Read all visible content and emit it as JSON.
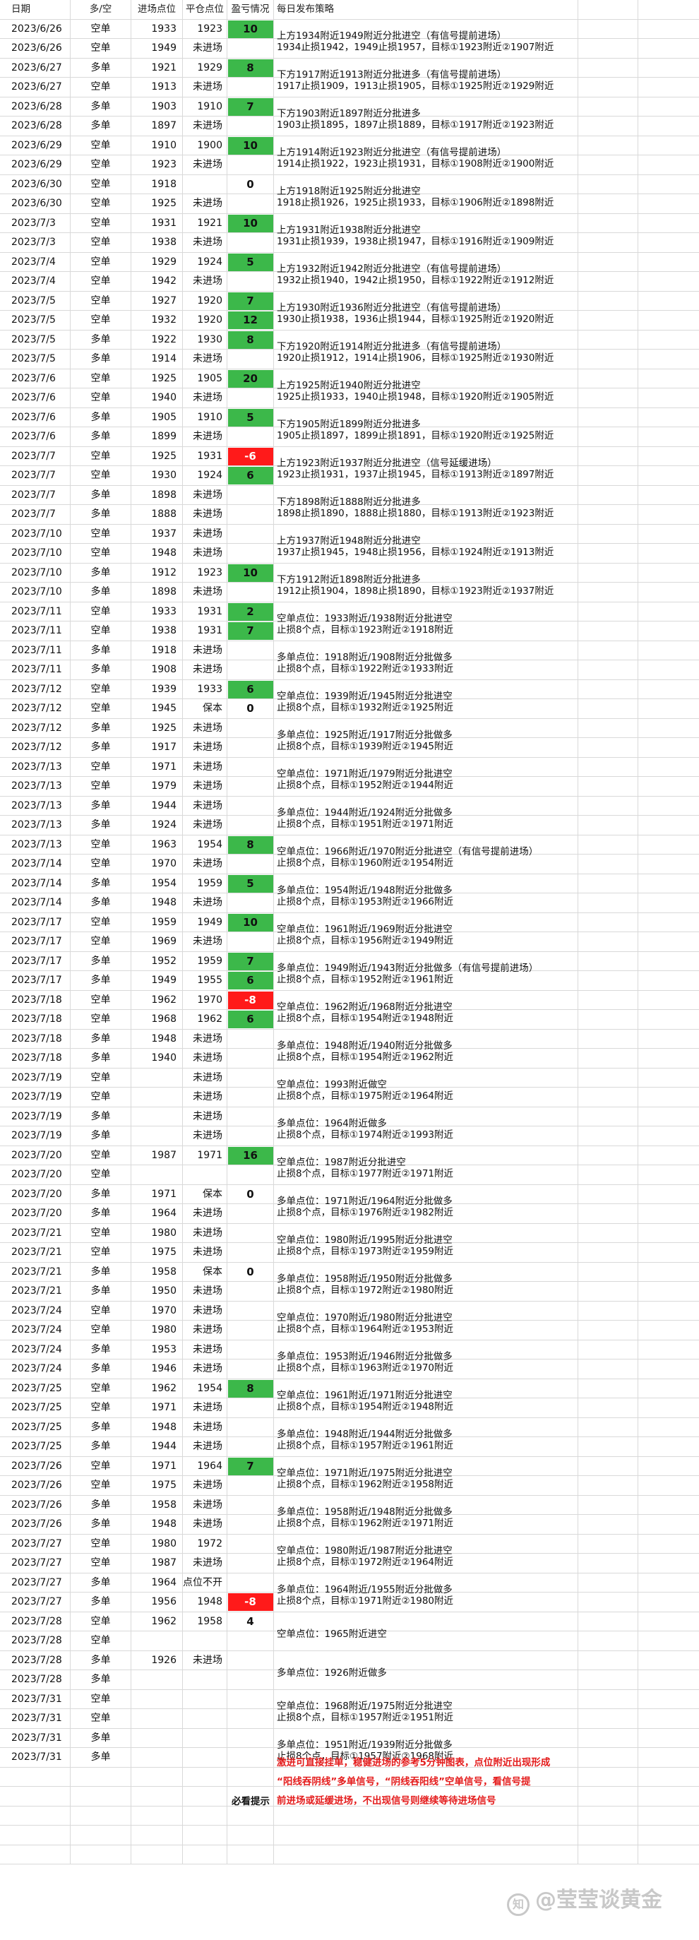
{
  "header": {
    "date": "日期",
    "direction": "多/空",
    "entry": "进场点位",
    "close": "平仓点位",
    "pnl": "盈亏情况",
    "strategy": "每日发布策略"
  },
  "rows": [
    {
      "date": "2023/6/26",
      "dir": "空单",
      "entry": "1933",
      "close": "1923",
      "pnl": "10",
      "pnl_color": "green"
    },
    {
      "date": "2023/6/26",
      "dir": "空单",
      "entry": "1949",
      "close": "未进场",
      "pnl": ""
    },
    {
      "date": "2023/6/27",
      "dir": "多单",
      "entry": "1921",
      "close": "1929",
      "pnl": "8",
      "pnl_color": "green"
    },
    {
      "date": "2023/6/27",
      "dir": "空单",
      "entry": "1913",
      "close": "未进场",
      "pnl": ""
    },
    {
      "date": "2023/6/28",
      "dir": "多单",
      "entry": "1903",
      "close": "1910",
      "pnl": "7",
      "pnl_color": "green"
    },
    {
      "date": "2023/6/28",
      "dir": "多单",
      "entry": "1897",
      "close": "未进场",
      "pnl": ""
    },
    {
      "date": "2023/6/29",
      "dir": "空单",
      "entry": "1910",
      "close": "1900",
      "pnl": "10",
      "pnl_color": "green"
    },
    {
      "date": "2023/6/29",
      "dir": "空单",
      "entry": "1923",
      "close": "未进场",
      "pnl": ""
    },
    {
      "date": "2023/6/30",
      "dir": "空单",
      "entry": "1918",
      "close": "",
      "pnl": "0",
      "pnl_color": "plain"
    },
    {
      "date": "2023/6/30",
      "dir": "空单",
      "entry": "1925",
      "close": "未进场",
      "pnl": ""
    },
    {
      "date": "2023/7/3",
      "dir": "空单",
      "entry": "1931",
      "close": "1921",
      "pnl": "10",
      "pnl_color": "green"
    },
    {
      "date": "2023/7/3",
      "dir": "空单",
      "entry": "1938",
      "close": "未进场",
      "pnl": ""
    },
    {
      "date": "2023/7/4",
      "dir": "空单",
      "entry": "1929",
      "close": "1924",
      "pnl": "5",
      "pnl_color": "green"
    },
    {
      "date": "2023/7/4",
      "dir": "空单",
      "entry": "1942",
      "close": "未进场",
      "pnl": ""
    },
    {
      "date": "2023/7/5",
      "dir": "空单",
      "entry": "1927",
      "close": "1920",
      "pnl": "7",
      "pnl_color": "green"
    },
    {
      "date": "2023/7/5",
      "dir": "空单",
      "entry": "1932",
      "close": "1920",
      "pnl": "12",
      "pnl_color": "green"
    },
    {
      "date": "2023/7/5",
      "dir": "多单",
      "entry": "1922",
      "close": "1930",
      "pnl": "8",
      "pnl_color": "green"
    },
    {
      "date": "2023/7/5",
      "dir": "多单",
      "entry": "1914",
      "close": "未进场",
      "pnl": ""
    },
    {
      "date": "2023/7/6",
      "dir": "空单",
      "entry": "1925",
      "close": "1905",
      "pnl": "20",
      "pnl_color": "green"
    },
    {
      "date": "2023/7/6",
      "dir": "空单",
      "entry": "1940",
      "close": "未进场",
      "pnl": ""
    },
    {
      "date": "2023/7/6",
      "dir": "多单",
      "entry": "1905",
      "close": "1910",
      "pnl": "5",
      "pnl_color": "green"
    },
    {
      "date": "2023/7/6",
      "dir": "多单",
      "entry": "1899",
      "close": "未进场",
      "pnl": ""
    },
    {
      "date": "2023/7/7",
      "dir": "空单",
      "entry": "1925",
      "close": "1931",
      "pnl": "-6",
      "pnl_color": "red"
    },
    {
      "date": "2023/7/7",
      "dir": "空单",
      "entry": "1930",
      "close": "1924",
      "pnl": "6",
      "pnl_color": "green"
    },
    {
      "date": "2023/7/7",
      "dir": "多单",
      "entry": "1898",
      "close": "未进场",
      "pnl": ""
    },
    {
      "date": "2023/7/7",
      "dir": "多单",
      "entry": "1888",
      "close": "未进场",
      "pnl": ""
    },
    {
      "date": "2023/7/10",
      "dir": "空单",
      "entry": "1937",
      "close": "未进场",
      "pnl": ""
    },
    {
      "date": "2023/7/10",
      "dir": "空单",
      "entry": "1948",
      "close": "未进场",
      "pnl": ""
    },
    {
      "date": "2023/7/10",
      "dir": "多单",
      "entry": "1912",
      "close": "1923",
      "pnl": "10",
      "pnl_color": "green"
    },
    {
      "date": "2023/7/10",
      "dir": "多单",
      "entry": "1898",
      "close": "未进场",
      "pnl": ""
    },
    {
      "date": "2023/7/11",
      "dir": "空单",
      "entry": "1933",
      "close": "1931",
      "pnl": "2",
      "pnl_color": "green"
    },
    {
      "date": "2023/7/11",
      "dir": "空单",
      "entry": "1938",
      "close": "1931",
      "pnl": "7",
      "pnl_color": "green"
    },
    {
      "date": "2023/7/11",
      "dir": "多单",
      "entry": "1918",
      "close": "未进场",
      "pnl": ""
    },
    {
      "date": "2023/7/11",
      "dir": "多单",
      "entry": "1908",
      "close": "未进场",
      "pnl": ""
    },
    {
      "date": "2023/7/12",
      "dir": "空单",
      "entry": "1939",
      "close": "1933",
      "pnl": "6",
      "pnl_color": "green"
    },
    {
      "date": "2023/7/12",
      "dir": "空单",
      "entry": "1945",
      "close": "保本",
      "pnl": "0",
      "pnl_color": "plain"
    },
    {
      "date": "2023/7/12",
      "dir": "多单",
      "entry": "1925",
      "close": "未进场",
      "pnl": ""
    },
    {
      "date": "2023/7/12",
      "dir": "多单",
      "entry": "1917",
      "close": "未进场",
      "pnl": ""
    },
    {
      "date": "2023/7/13",
      "dir": "空单",
      "entry": "1971",
      "close": "未进场",
      "pnl": ""
    },
    {
      "date": "2023/7/13",
      "dir": "空单",
      "entry": "1979",
      "close": "未进场",
      "pnl": ""
    },
    {
      "date": "2023/7/13",
      "dir": "多单",
      "entry": "1944",
      "close": "未进场",
      "pnl": ""
    },
    {
      "date": "2023/7/13",
      "dir": "多单",
      "entry": "1924",
      "close": "未进场",
      "pnl": ""
    },
    {
      "date": "2023/7/13",
      "dir": "空单",
      "entry": "1963",
      "close": "1954",
      "pnl": "8",
      "pnl_color": "green"
    },
    {
      "date": "2023/7/14",
      "dir": "空单",
      "entry": "1970",
      "close": "未进场",
      "pnl": ""
    },
    {
      "date": "2023/7/14",
      "dir": "多单",
      "entry": "1954",
      "close": "1959",
      "pnl": "5",
      "pnl_color": "green"
    },
    {
      "date": "2023/7/14",
      "dir": "多单",
      "entry": "1948",
      "close": "未进场",
      "pnl": ""
    },
    {
      "date": "2023/7/17",
      "dir": "空单",
      "entry": "1959",
      "close": "1949",
      "pnl": "10",
      "pnl_color": "green"
    },
    {
      "date": "2023/7/17",
      "dir": "空单",
      "entry": "1969",
      "close": "未进场",
      "pnl": ""
    },
    {
      "date": "2023/7/17",
      "dir": "多单",
      "entry": "1952",
      "close": "1959",
      "pnl": "7",
      "pnl_color": "green"
    },
    {
      "date": "2023/7/17",
      "dir": "多单",
      "entry": "1949",
      "close": "1955",
      "pnl": "6",
      "pnl_color": "green"
    },
    {
      "date": "2023/7/18",
      "dir": "空单",
      "entry": "1962",
      "close": "1970",
      "pnl": "-8",
      "pnl_color": "red"
    },
    {
      "date": "2023/7/18",
      "dir": "空单",
      "entry": "1968",
      "close": "1962",
      "pnl": "6",
      "pnl_color": "green"
    },
    {
      "date": "2023/7/18",
      "dir": "多单",
      "entry": "1948",
      "close": "未进场",
      "pnl": ""
    },
    {
      "date": "2023/7/18",
      "dir": "多单",
      "entry": "1940",
      "close": "未进场",
      "pnl": ""
    },
    {
      "date": "2023/7/19",
      "dir": "空单",
      "entry": "",
      "close": "未进场",
      "pnl": ""
    },
    {
      "date": "2023/7/19",
      "dir": "空单",
      "entry": "",
      "close": "未进场",
      "pnl": ""
    },
    {
      "date": "2023/7/19",
      "dir": "多单",
      "entry": "",
      "close": "未进场",
      "pnl": ""
    },
    {
      "date": "2023/7/19",
      "dir": "多单",
      "entry": "",
      "close": "未进场",
      "pnl": ""
    },
    {
      "date": "2023/7/20",
      "dir": "空单",
      "entry": "1987",
      "close": "1971",
      "pnl": "16",
      "pnl_color": "green"
    },
    {
      "date": "2023/7/20",
      "dir": "空单",
      "entry": "",
      "close": "",
      "pnl": ""
    },
    {
      "date": "2023/7/20",
      "dir": "多单",
      "entry": "1971",
      "close": "保本",
      "pnl": "0",
      "pnl_color": "plain"
    },
    {
      "date": "2023/7/20",
      "dir": "多单",
      "entry": "1964",
      "close": "未进场",
      "pnl": ""
    },
    {
      "date": "2023/7/21",
      "dir": "空单",
      "entry": "1980",
      "close": "未进场",
      "pnl": ""
    },
    {
      "date": "2023/7/21",
      "dir": "空单",
      "entry": "1975",
      "close": "未进场",
      "pnl": ""
    },
    {
      "date": "2023/7/21",
      "dir": "多单",
      "entry": "1958",
      "close": "保本",
      "pnl": "0",
      "pnl_color": "plain"
    },
    {
      "date": "2023/7/21",
      "dir": "多单",
      "entry": "1950",
      "close": "未进场",
      "pnl": ""
    },
    {
      "date": "2023/7/24",
      "dir": "空单",
      "entry": "1970",
      "close": "未进场",
      "pnl": ""
    },
    {
      "date": "2023/7/24",
      "dir": "空单",
      "entry": "1980",
      "close": "未进场",
      "pnl": ""
    },
    {
      "date": "2023/7/24",
      "dir": "多单",
      "entry": "1953",
      "close": "未进场",
      "pnl": ""
    },
    {
      "date": "2023/7/24",
      "dir": "多单",
      "entry": "1946",
      "close": "未进场",
      "pnl": ""
    },
    {
      "date": "2023/7/25",
      "dir": "空单",
      "entry": "1962",
      "close": "1954",
      "pnl": "8",
      "pnl_color": "green"
    },
    {
      "date": "2023/7/25",
      "dir": "空单",
      "entry": "1971",
      "close": "未进场",
      "pnl": ""
    },
    {
      "date": "2023/7/25",
      "dir": "多单",
      "entry": "1948",
      "close": "未进场",
      "pnl": ""
    },
    {
      "date": "2023/7/25",
      "dir": "多单",
      "entry": "1944",
      "close": "未进场",
      "pnl": ""
    },
    {
      "date": "2023/7/26",
      "dir": "空单",
      "entry": "1971",
      "close": "1964",
      "pnl": "7",
      "pnl_color": "green"
    },
    {
      "date": "2023/7/26",
      "dir": "空单",
      "entry": "1975",
      "close": "未进场",
      "pnl": ""
    },
    {
      "date": "2023/7/26",
      "dir": "多单",
      "entry": "1958",
      "close": "未进场",
      "pnl": ""
    },
    {
      "date": "2023/7/26",
      "dir": "多单",
      "entry": "1948",
      "close": "未进场",
      "pnl": ""
    },
    {
      "date": "2023/7/27",
      "dir": "空单",
      "entry": "1980",
      "close": "1972",
      "pnl": ""
    },
    {
      "date": "2023/7/27",
      "dir": "空单",
      "entry": "1987",
      "close": "未进场",
      "pnl": ""
    },
    {
      "date": "2023/7/27",
      "dir": "多单",
      "entry": "1964",
      "close": "点位不开",
      "pnl": ""
    },
    {
      "date": "2023/7/27",
      "dir": "多单",
      "entry": "1956",
      "close": "1948",
      "pnl": "-8",
      "pnl_color": "red"
    },
    {
      "date": "2023/7/28",
      "dir": "空单",
      "entry": "1962",
      "close": "1958",
      "pnl": "4",
      "pnl_color": "plain"
    },
    {
      "date": "2023/7/28",
      "dir": "空单",
      "entry": "",
      "close": "",
      "pnl": ""
    },
    {
      "date": "2023/7/28",
      "dir": "多单",
      "entry": "1926",
      "close": "未进场",
      "pnl": ""
    },
    {
      "date": "2023/7/28",
      "dir": "多单",
      "entry": "",
      "close": "",
      "pnl": ""
    },
    {
      "date": "2023/7/31",
      "dir": "空单",
      "entry": "",
      "close": "",
      "pnl": ""
    },
    {
      "date": "2023/7/31",
      "dir": "空单",
      "entry": "",
      "close": "",
      "pnl": ""
    },
    {
      "date": "2023/7/31",
      "dir": "多单",
      "entry": "",
      "close": "",
      "pnl": ""
    },
    {
      "date": "2023/7/31",
      "dir": "多单",
      "entry": "",
      "close": "",
      "pnl": ""
    }
  ],
  "strategies": [
    {
      "row": 0,
      "lines": [
        "上方1934附近1949附近分批进空（有信号提前进场）",
        "1934止损1942，1949止损1957，目标①1923附近②1907附近"
      ]
    },
    {
      "row": 2,
      "lines": [
        "下方1917附近1913附近分批进多（有信号提前进场）",
        "1917止损1909，1913止损1905，目标①1925附近②1929附近"
      ]
    },
    {
      "row": 4,
      "lines": [
        "下方1903附近1897附近分批进多",
        "1903止损1895，1897止损1889，目标①1917附近②1923附近"
      ]
    },
    {
      "row": 6,
      "lines": [
        "上方1914附近1923附近分批进空（有信号提前进场）",
        "1914止损1922，1923止损1931，目标①1908附近②1900附近"
      ]
    },
    {
      "row": 8,
      "lines": [
        "上方1918附近1925附近分批进空",
        "1918止损1926，1925止损1933，目标①1906附近②1898附近"
      ]
    },
    {
      "row": 10,
      "lines": [
        "上方1931附近1938附近分批进空",
        "1931止损1939，1938止损1947，目标①1916附近②1909附近"
      ]
    },
    {
      "row": 12,
      "lines": [
        "上方1932附近1942附近分批进空（有信号提前进场）",
        "1932止损1940，1942止损1950，目标①1922附近②1912附近"
      ]
    },
    {
      "row": 14,
      "lines": [
        "上方1930附近1936附近分批进空（有信号提前进场）",
        "1930止损1938，1936止损1944，目标①1925附近②1920附近"
      ]
    },
    {
      "row": 16,
      "lines": [
        "下方1920附近1914附近分批进多（有信号提前进场）",
        "1920止损1912，1914止损1906，目标①1925附近②1930附近"
      ]
    },
    {
      "row": 18,
      "lines": [
        "上方1925附近1940附近分批进空",
        "1925止损1933，1940止损1948，目标①1920附近②1905附近"
      ]
    },
    {
      "row": 20,
      "lines": [
        "下方1905附近1899附近分批进多",
        "1905止损1897，1899止损1891，目标①1920附近②1925附近"
      ]
    },
    {
      "row": 22,
      "lines": [
        "上方1923附近1937附近分批进空（信号延缓进场）",
        "1923止损1931，1937止损1945，目标①1913附近②1897附近"
      ]
    },
    {
      "row": 24,
      "lines": [
        "下方1898附近1888附近分批进多",
        "1898止损1890，1888止损1880，目标①1913附近②1923附近"
      ]
    },
    {
      "row": 26,
      "lines": [
        "上方1937附近1948附近分批进空",
        "1937止损1945，1948止损1956，目标①1924附近②1913附近"
      ]
    },
    {
      "row": 28,
      "lines": [
        "下方1912附近1898附近分批进多",
        "1912止损1904，1898止损1890，目标①1923附近②1937附近"
      ]
    },
    {
      "row": 30,
      "lines": [
        "空单点位：1933附近/1938附近分批进空",
        "止损8个点，目标①1923附近②1918附近"
      ]
    },
    {
      "row": 32,
      "lines": [
        "多单点位：1918附近/1908附近分批做多",
        "止损8个点，目标①1922附近②1933附近"
      ]
    },
    {
      "row": 34,
      "lines": [
        "空单点位：1939附近/1945附近分批进空",
        "止损8个点，目标①1932附近②1925附近"
      ]
    },
    {
      "row": 36,
      "lines": [
        "多单点位：1925附近/1917附近分批做多",
        "止损8个点，目标①1939附近②1945附近"
      ]
    },
    {
      "row": 38,
      "lines": [
        "空单点位：1971附近/1979附近分批进空",
        "止损8个点，目标①1952附近②1944附近"
      ]
    },
    {
      "row": 40,
      "lines": [
        "多单点位：1944附近/1924附近分批做多",
        "止损8个点，目标①1951附近②1971附近"
      ]
    },
    {
      "row": 42,
      "lines": [
        "空单点位：1966附近/1970附近分批进空（有信号提前进场）",
        "止损8个点，目标①1960附近②1954附近"
      ]
    },
    {
      "row": 44,
      "lines": [
        "多单点位：1954附近/1948附近分批做多",
        "止损8个点，目标①1953附近②1966附近"
      ]
    },
    {
      "row": 46,
      "lines": [
        "空单点位：1961附近/1969附近分批进空",
        "止损8个点，目标①1956附近②1949附近"
      ]
    },
    {
      "row": 48,
      "lines": [
        "多单点位：1949附近/1943附近分批做多（有信号提前进场）",
        "止损8个点，目标①1952附近②1961附近"
      ]
    },
    {
      "row": 50,
      "lines": [
        "空单点位：1962附近/1968附近分批进空",
        "止损8个点，目标①1954附近②1948附近"
      ]
    },
    {
      "row": 52,
      "lines": [
        "多单点位：1948附近/1940附近分批做多",
        "止损8个点，目标①1954附近②1962附近"
      ]
    },
    {
      "row": 54,
      "lines": [
        "空单点位：1993附近做空",
        "止损8个点，目标①1975附近②1964附近"
      ]
    },
    {
      "row": 56,
      "lines": [
        "多单点位：1964附近做多",
        "止损8个点，目标①1974附近②1993附近"
      ]
    },
    {
      "row": 58,
      "lines": [
        "空单点位：1987附近分批进空",
        "止损8个点，目标①1977附近②1971附近"
      ]
    },
    {
      "row": 60,
      "lines": [
        "多单点位：1971附近/1964附近分批做多",
        "止损8个点，目标①1976附近②1982附近"
      ]
    },
    {
      "row": 62,
      "lines": [
        "空单点位：1980附近/1995附近分批进空",
        "止损8个点，目标①1973附近②1959附近"
      ]
    },
    {
      "row": 64,
      "lines": [
        "多单点位：1958附近/1950附近分批做多",
        "止损8个点，目标①1972附近②1980附近"
      ]
    },
    {
      "row": 66,
      "lines": [
        "空单点位：1970附近/1980附近分批进空",
        "止损8个点，目标①1964附近②1953附近"
      ]
    },
    {
      "row": 68,
      "lines": [
        "多单点位：1953附近/1946附近分批做多",
        "止损8个点，目标①1963附近②1970附近"
      ]
    },
    {
      "row": 70,
      "lines": [
        "空单点位：1961附近/1971附近分批进空",
        "止损8个点，目标①1954附近②1948附近"
      ]
    },
    {
      "row": 72,
      "lines": [
        "多单点位：1948附近/1944附近分批做多",
        "止损8个点，目标①1957附近②1961附近"
      ]
    },
    {
      "row": 74,
      "lines": [
        "空单点位：1971附近/1975附近分批进空",
        "止损8个点，目标①1962附近②1958附近"
      ]
    },
    {
      "row": 76,
      "lines": [
        "多单点位：1958附近/1948附近分批做多",
        "止损8个点，目标①1962附近②1971附近"
      ]
    },
    {
      "row": 78,
      "lines": [
        "空单点位：1980附近/1987附近分批进空",
        "止损8个点，目标①1972附近②1964附近"
      ]
    },
    {
      "row": 80,
      "lines": [
        "多单点位：1964附近/1955附近分批做多",
        "止损8个点，目标①1971附近②1980附近"
      ]
    },
    {
      "row": 82,
      "lines": [
        "空单点位：1965附近进空"
      ]
    },
    {
      "row": 84,
      "lines": [
        "多单点位：1926附近做多"
      ]
    },
    {
      "row": 86,
      "lines": [
        "空单点位：1968附近/1975附近分批进空",
        "止损8个点，目标①1957附近②1951附近"
      ]
    },
    {
      "row": 88,
      "lines": [
        "多单点位：1951附近/1939附近分批做多",
        "止损8个点，目标①1957附近②1968附近"
      ]
    }
  ],
  "note": {
    "label": "必看提示",
    "text_lines": [
      "激进可直接挂单，稳健进场的参考5分钟图表，点位附近出现形成",
      "“阳线吞阴线”多单信号，“阴线吞阳线”空单信号，看信号提",
      "前进场或延缓进场，不出现信号则继续等待进场信号"
    ]
  },
  "watermark": {
    "icon_text": "知",
    "text": "@莹莹谈黄金"
  },
  "colors": {
    "green": "#3cb84a",
    "red": "#ff1a1a",
    "note_text": "#e41c1c"
  }
}
